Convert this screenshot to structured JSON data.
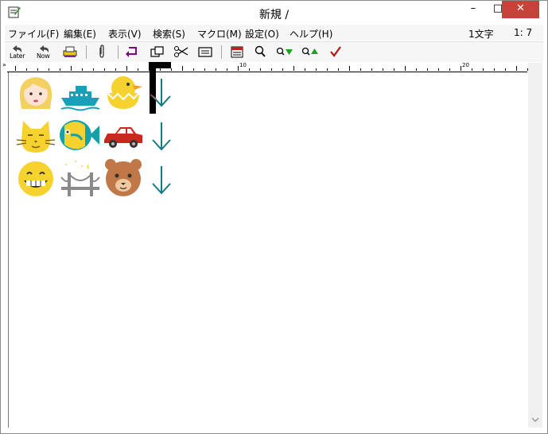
{
  "window": {
    "title": "新規  /"
  },
  "title_controls": {
    "minimize": "–",
    "maximize": "□",
    "close": "✕"
  },
  "menu": [
    {
      "label": "ファイル(F)"
    },
    {
      "label": "編集(E)"
    },
    {
      "label": "表示(V)"
    },
    {
      "label": "検索(S)"
    },
    {
      "label": "マクロ(M)"
    },
    {
      "label": "設定(O)"
    },
    {
      "label": "ヘルプ(H)"
    }
  ],
  "status": {
    "chars": "1文字",
    "position": "1: 7"
  },
  "toolbar": {
    "later_label": "Later",
    "now_label": "Now"
  },
  "ruler": {
    "marks": [
      "10",
      "20"
    ]
  },
  "editor": {
    "rows": [
      [
        "woman-face-icon",
        "ship-icon",
        "hatching-chick-icon"
      ],
      [
        "cat-face-icon",
        "tropical-fish-icon",
        "car-icon"
      ],
      [
        "grinning-face-icon",
        "bridge-at-night-icon",
        "bear-face-icon"
      ]
    ],
    "line_end_marker": "down-arrow-icon"
  },
  "colors": {
    "close_button": "#c7423b",
    "arrow": "#147a80"
  }
}
